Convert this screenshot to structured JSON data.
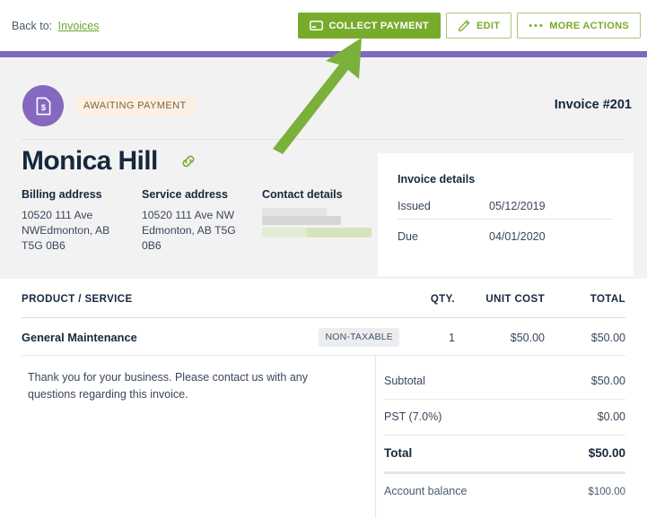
{
  "topbar": {
    "back_prefix": "Back to:",
    "back_link": "Invoices",
    "buttons": [
      {
        "label": "COLLECT PAYMENT",
        "icon": "credit-card-icon",
        "style": "primary"
      },
      {
        "label": "EDIT",
        "icon": "pencil-icon",
        "style": "outline"
      },
      {
        "label": "MORE ACTIONS",
        "icon": "ellipsis-icon",
        "style": "outline"
      }
    ]
  },
  "header": {
    "avatar_icon": "invoice-document-dollar-icon",
    "status": "AWAITING PAYMENT",
    "invoice_number": "Invoice #201",
    "customer_name": "Monica Hill",
    "link_icon": "chain-link-icon"
  },
  "addresses": {
    "billing": {
      "title": "Billing address",
      "lines": "10520 111 Ave NWEdmonton, AB T5G 0B6"
    },
    "service": {
      "title": "Service address",
      "lines": "10520 111 Ave NW Edmonton, AB T5G 0B6"
    },
    "contact": {
      "title": "Contact details",
      "redacted": true
    }
  },
  "invoice_details": {
    "title": "Invoice details",
    "rows": [
      {
        "label": "Issued",
        "value": "05/12/2019"
      },
      {
        "label": "Due",
        "value": "04/01/2020"
      }
    ]
  },
  "line_items": {
    "columns": {
      "product": "PRODUCT / SERVICE",
      "qty": "QTY.",
      "unit_cost": "UNIT COST",
      "total": "TOTAL"
    },
    "rows": [
      {
        "product": "General Maintenance",
        "tax_badge": "NON-TAXABLE",
        "qty": "1",
        "unit_cost": "$50.00",
        "total": "$50.00"
      }
    ]
  },
  "note": "Thank you for your business. Please contact us with any questions regarding this invoice.",
  "totals": [
    {
      "label": "Subtotal",
      "value": "$50.00"
    },
    {
      "label": "PST (7.0%)",
      "value": "$0.00"
    },
    {
      "label": "Total",
      "value": "$50.00"
    },
    {
      "label": "Account balance",
      "value": "$100.00"
    }
  ],
  "colors": {
    "brand_green": "#78ab2b",
    "accent_purple": "#7e6ab8",
    "avatar_purple": "#8668c0",
    "status_badge_bg": "#fbf0e2",
    "status_badge_text": "#7d6243",
    "annotation_arrow": "#7bb03a",
    "text_dark": "#15283e",
    "panel_gray": "#f2f2f2"
  },
  "annotation": {
    "type": "arrow",
    "points_to": "COLLECT PAYMENT"
  }
}
